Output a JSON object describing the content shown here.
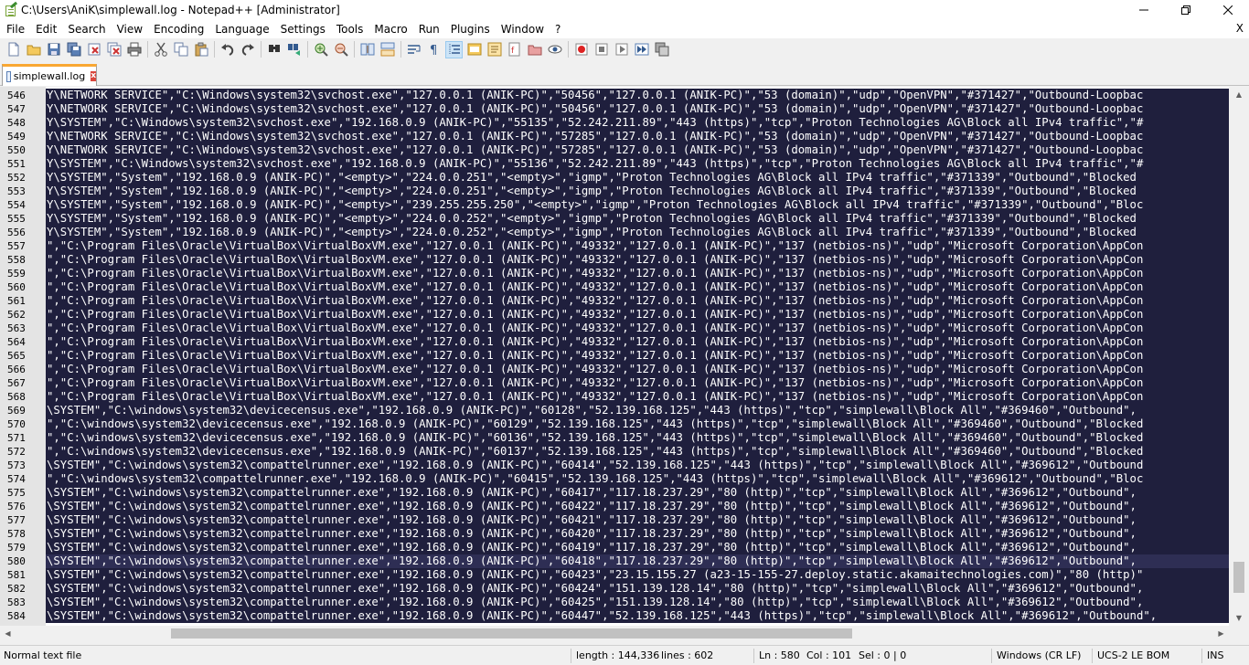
{
  "window": {
    "title": "C:\\Users\\AniK\\simplewall.log - Notepad++ [Administrator]",
    "minimize_icon": "minimize-icon",
    "maximize_icon": "restore-icon",
    "close_icon": "close-icon"
  },
  "menubar": {
    "items": [
      "File",
      "Edit",
      "Search",
      "View",
      "Encoding",
      "Language",
      "Settings",
      "Tools",
      "Macro",
      "Run",
      "Plugins",
      "Window",
      "?"
    ],
    "close_glyph": "X"
  },
  "toolbar": {
    "icons": [
      "new-file-icon",
      "open-file-icon",
      "save-icon",
      "save-all-icon",
      "close-file-icon",
      "close-all-icon",
      "print-icon",
      "cut-icon",
      "copy-icon",
      "paste-icon",
      "undo-icon",
      "redo-icon",
      "find-icon",
      "replace-icon",
      "zoom-in-icon",
      "zoom-out-icon",
      "sync-vertical-icon",
      "sync-horizontal-icon",
      "word-wrap-icon",
      "show-all-chars-icon",
      "indent-guide-icon",
      "doc-map-icon",
      "function-list-icon",
      "folder-workspace-icon",
      "doc-switcher-icon",
      "monitoring-icon",
      "record-macro-icon",
      "stop-record-icon",
      "playback-macro-icon",
      "run-macro-multiple-icon",
      "save-macro-icon"
    ]
  },
  "tab": {
    "label": "simplewall.log",
    "close_glyph": "x"
  },
  "editor": {
    "current_line": 580,
    "lines": [
      {
        "n": "546",
        "text": "Y\\NETWORK SERVICE\",\"C:\\Windows\\system32\\svchost.exe\",\"127.0.0.1 (ANIK-PC)\",\"50456\",\"127.0.0.1 (ANIK-PC)\",\"53 (domain)\",\"udp\",\"OpenVPN\",\"#371427\",\"Outbound-Loopbac"
      },
      {
        "n": "547",
        "text": "Y\\NETWORK SERVICE\",\"C:\\Windows\\system32\\svchost.exe\",\"127.0.0.1 (ANIK-PC)\",\"50456\",\"127.0.0.1 (ANIK-PC)\",\"53 (domain)\",\"udp\",\"OpenVPN\",\"#371427\",\"Outbound-Loopbac"
      },
      {
        "n": "548",
        "text": "Y\\SYSTEM\",\"C:\\Windows\\system32\\svchost.exe\",\"192.168.0.9 (ANIK-PC)\",\"55135\",\"52.242.211.89\",\"443 (https)\",\"tcp\",\"Proton Technologies AG\\Block all IPv4 traffic\",\"#"
      },
      {
        "n": "549",
        "text": "Y\\NETWORK SERVICE\",\"C:\\Windows\\system32\\svchost.exe\",\"127.0.0.1 (ANIK-PC)\",\"57285\",\"127.0.0.1 (ANIK-PC)\",\"53 (domain)\",\"udp\",\"OpenVPN\",\"#371427\",\"Outbound-Loopbac"
      },
      {
        "n": "550",
        "text": "Y\\NETWORK SERVICE\",\"C:\\Windows\\system32\\svchost.exe\",\"127.0.0.1 (ANIK-PC)\",\"57285\",\"127.0.0.1 (ANIK-PC)\",\"53 (domain)\",\"udp\",\"OpenVPN\",\"#371427\",\"Outbound-Loopbac"
      },
      {
        "n": "551",
        "text": "Y\\SYSTEM\",\"C:\\Windows\\system32\\svchost.exe\",\"192.168.0.9 (ANIK-PC)\",\"55136\",\"52.242.211.89\",\"443 (https)\",\"tcp\",\"Proton Technologies AG\\Block all IPv4 traffic\",\"#"
      },
      {
        "n": "552",
        "text": "Y\\SYSTEM\",\"System\",\"192.168.0.9 (ANIK-PC)\",\"<empty>\",\"224.0.0.251\",\"<empty>\",\"igmp\",\"Proton Technologies AG\\Block all IPv4 traffic\",\"#371339\",\"Outbound\",\"Blocked"
      },
      {
        "n": "553",
        "text": "Y\\SYSTEM\",\"System\",\"192.168.0.9 (ANIK-PC)\",\"<empty>\",\"224.0.0.251\",\"<empty>\",\"igmp\",\"Proton Technologies AG\\Block all IPv4 traffic\",\"#371339\",\"Outbound\",\"Blocked"
      },
      {
        "n": "554",
        "text": "Y\\SYSTEM\",\"System\",\"192.168.0.9 (ANIK-PC)\",\"<empty>\",\"239.255.255.250\",\"<empty>\",\"igmp\",\"Proton Technologies AG\\Block all IPv4 traffic\",\"#371339\",\"Outbound\",\"Bloc"
      },
      {
        "n": "555",
        "text": "Y\\SYSTEM\",\"System\",\"192.168.0.9 (ANIK-PC)\",\"<empty>\",\"224.0.0.252\",\"<empty>\",\"igmp\",\"Proton Technologies AG\\Block all IPv4 traffic\",\"#371339\",\"Outbound\",\"Blocked"
      },
      {
        "n": "556",
        "text": "Y\\SYSTEM\",\"System\",\"192.168.0.9 (ANIK-PC)\",\"<empty>\",\"224.0.0.252\",\"<empty>\",\"igmp\",\"Proton Technologies AG\\Block all IPv4 traffic\",\"#371339\",\"Outbound\",\"Blocked"
      },
      {
        "n": "557",
        "text": "\",\"C:\\Program Files\\Oracle\\VirtualBox\\VirtualBoxVM.exe\",\"127.0.0.1 (ANIK-PC)\",\"49332\",\"127.0.0.1 (ANIK-PC)\",\"137 (netbios-ns)\",\"udp\",\"Microsoft Corporation\\AppCon"
      },
      {
        "n": "558",
        "text": "\",\"C:\\Program Files\\Oracle\\VirtualBox\\VirtualBoxVM.exe\",\"127.0.0.1 (ANIK-PC)\",\"49332\",\"127.0.0.1 (ANIK-PC)\",\"137 (netbios-ns)\",\"udp\",\"Microsoft Corporation\\AppCon"
      },
      {
        "n": "559",
        "text": "\",\"C:\\Program Files\\Oracle\\VirtualBox\\VirtualBoxVM.exe\",\"127.0.0.1 (ANIK-PC)\",\"49332\",\"127.0.0.1 (ANIK-PC)\",\"137 (netbios-ns)\",\"udp\",\"Microsoft Corporation\\AppCon"
      },
      {
        "n": "560",
        "text": "\",\"C:\\Program Files\\Oracle\\VirtualBox\\VirtualBoxVM.exe\",\"127.0.0.1 (ANIK-PC)\",\"49332\",\"127.0.0.1 (ANIK-PC)\",\"137 (netbios-ns)\",\"udp\",\"Microsoft Corporation\\AppCon"
      },
      {
        "n": "561",
        "text": "\",\"C:\\Program Files\\Oracle\\VirtualBox\\VirtualBoxVM.exe\",\"127.0.0.1 (ANIK-PC)\",\"49332\",\"127.0.0.1 (ANIK-PC)\",\"137 (netbios-ns)\",\"udp\",\"Microsoft Corporation\\AppCon"
      },
      {
        "n": "562",
        "text": "\",\"C:\\Program Files\\Oracle\\VirtualBox\\VirtualBoxVM.exe\",\"127.0.0.1 (ANIK-PC)\",\"49332\",\"127.0.0.1 (ANIK-PC)\",\"137 (netbios-ns)\",\"udp\",\"Microsoft Corporation\\AppCon"
      },
      {
        "n": "563",
        "text": "\",\"C:\\Program Files\\Oracle\\VirtualBox\\VirtualBoxVM.exe\",\"127.0.0.1 (ANIK-PC)\",\"49332\",\"127.0.0.1 (ANIK-PC)\",\"137 (netbios-ns)\",\"udp\",\"Microsoft Corporation\\AppCon"
      },
      {
        "n": "564",
        "text": "\",\"C:\\Program Files\\Oracle\\VirtualBox\\VirtualBoxVM.exe\",\"127.0.0.1 (ANIK-PC)\",\"49332\",\"127.0.0.1 (ANIK-PC)\",\"137 (netbios-ns)\",\"udp\",\"Microsoft Corporation\\AppCon"
      },
      {
        "n": "565",
        "text": "\",\"C:\\Program Files\\Oracle\\VirtualBox\\VirtualBoxVM.exe\",\"127.0.0.1 (ANIK-PC)\",\"49332\",\"127.0.0.1 (ANIK-PC)\",\"137 (netbios-ns)\",\"udp\",\"Microsoft Corporation\\AppCon"
      },
      {
        "n": "566",
        "text": "\",\"C:\\Program Files\\Oracle\\VirtualBox\\VirtualBoxVM.exe\",\"127.0.0.1 (ANIK-PC)\",\"49332\",\"127.0.0.1 (ANIK-PC)\",\"137 (netbios-ns)\",\"udp\",\"Microsoft Corporation\\AppCon"
      },
      {
        "n": "567",
        "text": "\",\"C:\\Program Files\\Oracle\\VirtualBox\\VirtualBoxVM.exe\",\"127.0.0.1 (ANIK-PC)\",\"49332\",\"127.0.0.1 (ANIK-PC)\",\"137 (netbios-ns)\",\"udp\",\"Microsoft Corporation\\AppCon"
      },
      {
        "n": "568",
        "text": "\",\"C:\\Program Files\\Oracle\\VirtualBox\\VirtualBoxVM.exe\",\"127.0.0.1 (ANIK-PC)\",\"49332\",\"127.0.0.1 (ANIK-PC)\",\"137 (netbios-ns)\",\"udp\",\"Microsoft Corporation\\AppCon"
      },
      {
        "n": "569",
        "text": "\\SYSTEM\",\"C:\\windows\\system32\\devicecensus.exe\",\"192.168.0.9 (ANIK-PC)\",\"60128\",\"52.139.168.125\",\"443 (https)\",\"tcp\",\"simplewall\\Block All\",\"#369460\",\"Outbound\","
      },
      {
        "n": "570",
        "text": "\",\"C:\\windows\\system32\\devicecensus.exe\",\"192.168.0.9 (ANIK-PC)\",\"60129\",\"52.139.168.125\",\"443 (https)\",\"tcp\",\"simplewall\\Block All\",\"#369460\",\"Outbound\",\"Blocked"
      },
      {
        "n": "571",
        "text": "\",\"C:\\windows\\system32\\devicecensus.exe\",\"192.168.0.9 (ANIK-PC)\",\"60136\",\"52.139.168.125\",\"443 (https)\",\"tcp\",\"simplewall\\Block All\",\"#369460\",\"Outbound\",\"Blocked"
      },
      {
        "n": "572",
        "text": "\",\"C:\\windows\\system32\\devicecensus.exe\",\"192.168.0.9 (ANIK-PC)\",\"60137\",\"52.139.168.125\",\"443 (https)\",\"tcp\",\"simplewall\\Block All\",\"#369460\",\"Outbound\",\"Blocked"
      },
      {
        "n": "573",
        "text": "\\SYSTEM\",\"C:\\windows\\system32\\compattelrunner.exe\",\"192.168.0.9 (ANIK-PC)\",\"60414\",\"52.139.168.125\",\"443 (https)\",\"tcp\",\"simplewall\\Block All\",\"#369612\",\"Outbound"
      },
      {
        "n": "574",
        "text": "\",\"C:\\windows\\system32\\compattelrunner.exe\",\"192.168.0.9 (ANIK-PC)\",\"60415\",\"52.139.168.125\",\"443 (https)\",\"tcp\",\"simplewall\\Block All\",\"#369612\",\"Outbound\",\"Bloc"
      },
      {
        "n": "575",
        "text": "\\SYSTEM\",\"C:\\windows\\system32\\compattelrunner.exe\",\"192.168.0.9 (ANIK-PC)\",\"60417\",\"117.18.237.29\",\"80 (http)\",\"tcp\",\"simplewall\\Block All\",\"#369612\",\"Outbound\","
      },
      {
        "n": "576",
        "text": "\\SYSTEM\",\"C:\\windows\\system32\\compattelrunner.exe\",\"192.168.0.9 (ANIK-PC)\",\"60422\",\"117.18.237.29\",\"80 (http)\",\"tcp\",\"simplewall\\Block All\",\"#369612\",\"Outbound\","
      },
      {
        "n": "577",
        "text": "\\SYSTEM\",\"C:\\windows\\system32\\compattelrunner.exe\",\"192.168.0.9 (ANIK-PC)\",\"60421\",\"117.18.237.29\",\"80 (http)\",\"tcp\",\"simplewall\\Block All\",\"#369612\",\"Outbound\","
      },
      {
        "n": "578",
        "text": "\\SYSTEM\",\"C:\\windows\\system32\\compattelrunner.exe\",\"192.168.0.9 (ANIK-PC)\",\"60420\",\"117.18.237.29\",\"80 (http)\",\"tcp\",\"simplewall\\Block All\",\"#369612\",\"Outbound\","
      },
      {
        "n": "579",
        "text": "\\SYSTEM\",\"C:\\windows\\system32\\compattelrunner.exe\",\"192.168.0.9 (ANIK-PC)\",\"60419\",\"117.18.237.29\",\"80 (http)\",\"tcp\",\"simplewall\\Block All\",\"#369612\",\"Outbound\","
      },
      {
        "n": "580",
        "text": "\\SYSTEM\",\"C:\\windows\\system32\\compattelrunner.exe\",\"192.168.0.9 (ANIK-PC)\",\"60418\",\"117.18.237.29\",\"80 (http)\",\"tcp\",\"simplewall\\Block All\",\"#369612\",\"Outbound\","
      },
      {
        "n": "581",
        "text": "\\SYSTEM\",\"C:\\windows\\system32\\compattelrunner.exe\",\"192.168.0.9 (ANIK-PC)\",\"60423\",\"23.15.155.27 (a23-15-155-27.deploy.static.akamaitechnologies.com)\",\"80 (http)\""
      },
      {
        "n": "582",
        "text": "\\SYSTEM\",\"C:\\windows\\system32\\compattelrunner.exe\",\"192.168.0.9 (ANIK-PC)\",\"60424\",\"151.139.128.14\",\"80 (http)\",\"tcp\",\"simplewall\\Block All\",\"#369612\",\"Outbound\","
      },
      {
        "n": "583",
        "text": "\\SYSTEM\",\"C:\\windows\\system32\\compattelrunner.exe\",\"192.168.0.9 (ANIK-PC)\",\"60425\",\"151.139.128.14\",\"80 (http)\",\"tcp\",\"simplewall\\Block All\",\"#369612\",\"Outbound\","
      },
      {
        "n": "584",
        "text": "\\SYSTEM\",\"C:\\windows\\system32\\compattelrunner.exe\",\"192.168.0.9 (ANIK-PC)\",\"60447\",\"52.139.168.125\",\"443 (https)\",\"tcp\",\"simplewall\\Block All\",\"#369612\",\"Outbound\","
      }
    ]
  },
  "statusbar": {
    "file_type": "Normal text file",
    "length": "length : 144,336",
    "lines": "lines : 602",
    "ln": "Ln : 580",
    "col": "Col : 101",
    "sel": "Sel : 0 | 0",
    "eol": "Windows (CR LF)",
    "encoding": "UCS-2 LE BOM",
    "mode": "INS"
  },
  "colors": {
    "selection_bg": "#1f1f3d",
    "selection_fg": "#ffffff",
    "gutter_bg": "#e4e4e4",
    "tab_accent": "#f9a732"
  }
}
